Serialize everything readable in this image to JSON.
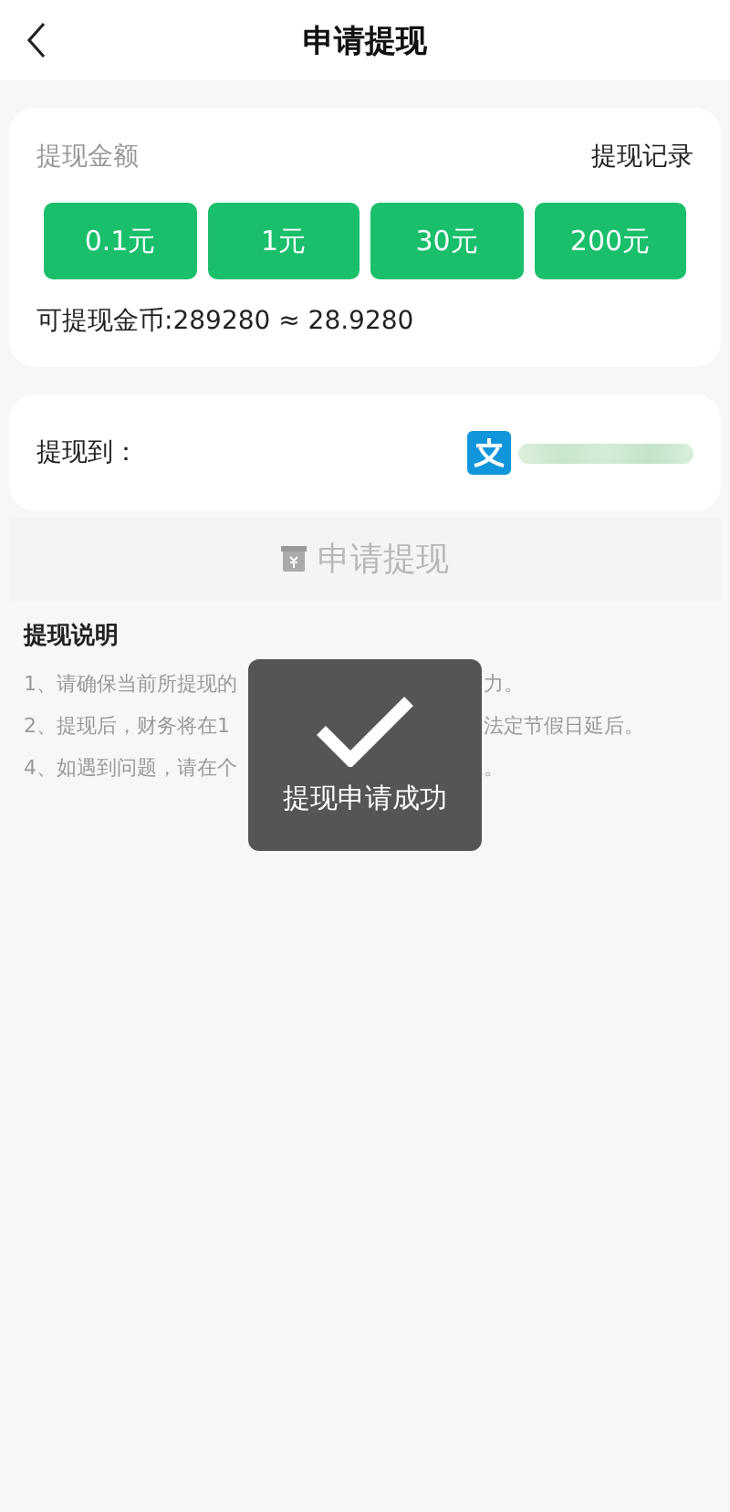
{
  "header": {
    "title": "申请提现"
  },
  "amount_card": {
    "label": "提现金额",
    "records_link": "提现记录",
    "amounts": [
      "0.1元",
      "1元",
      "30元",
      "200元"
    ],
    "balance": "可提现金币:289280 ≈ 28.9280"
  },
  "destination": {
    "label": "提现到：",
    "masked": true
  },
  "submit": {
    "label": "申请提现",
    "disabled": true
  },
  "notes": {
    "title": "提现说明",
    "lines": [
      {
        "left": "1、请确保当前所提现的",
        "right": "力。"
      },
      {
        "left": "2、提现后，财务将在1",
        "right": "法定节假日延后。"
      },
      {
        "left": "4、如遇到问题，请在个",
        "right": "。"
      }
    ]
  },
  "toast": {
    "message": "提现申请成功"
  }
}
